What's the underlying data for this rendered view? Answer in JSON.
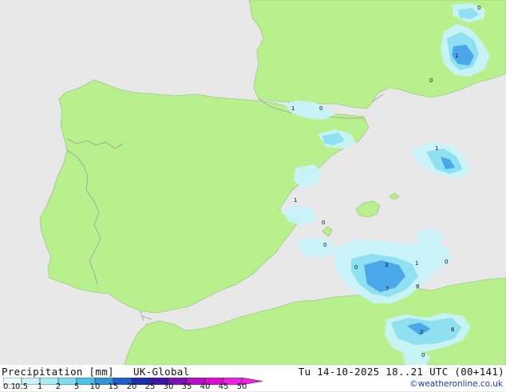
{
  "header": {
    "title": "Precipitation [mm]",
    "model": "UK-Global",
    "valid_time": "Tu 14-10-2025 18..21 UTC (00+141)"
  },
  "credit": "©weatheronline.co.uk",
  "colors": {
    "land": "#b8f08e",
    "sea": "#e8e8e8",
    "border": "#9a9a9a",
    "precip_light": "#c8f4fa",
    "precip_mid": "#8fe0f0",
    "precip_strong": "#4aa8e8"
  },
  "legend": {
    "ticks": [
      "0.1",
      "0.5",
      "1",
      "2",
      "5",
      "10",
      "15",
      "20",
      "25",
      "30",
      "35",
      "40",
      "45",
      "50"
    ],
    "colors": [
      "#e9fcfe",
      "#cbf3fb",
      "#a9ecf8",
      "#7ddbf2",
      "#4cc2ea",
      "#2c93dc",
      "#1e5fcb",
      "#1a2fb0",
      "#3d18a8",
      "#7a10b8",
      "#b80ec8",
      "#dc0cd4",
      "#ee22e2"
    ]
  },
  "map_labels": [
    {
      "text": "0"
    },
    {
      "text": "1"
    },
    {
      "text": "0"
    },
    {
      "text": "1"
    },
    {
      "text": "0"
    },
    {
      "text": "1"
    },
    {
      "text": "1"
    },
    {
      "text": "0"
    },
    {
      "text": "0"
    },
    {
      "text": "0"
    },
    {
      "text": "3"
    },
    {
      "text": "1"
    },
    {
      "text": "0"
    },
    {
      "text": "7"
    },
    {
      "text": "8"
    },
    {
      "text": "2"
    },
    {
      "text": "6"
    },
    {
      "text": "0"
    }
  ]
}
